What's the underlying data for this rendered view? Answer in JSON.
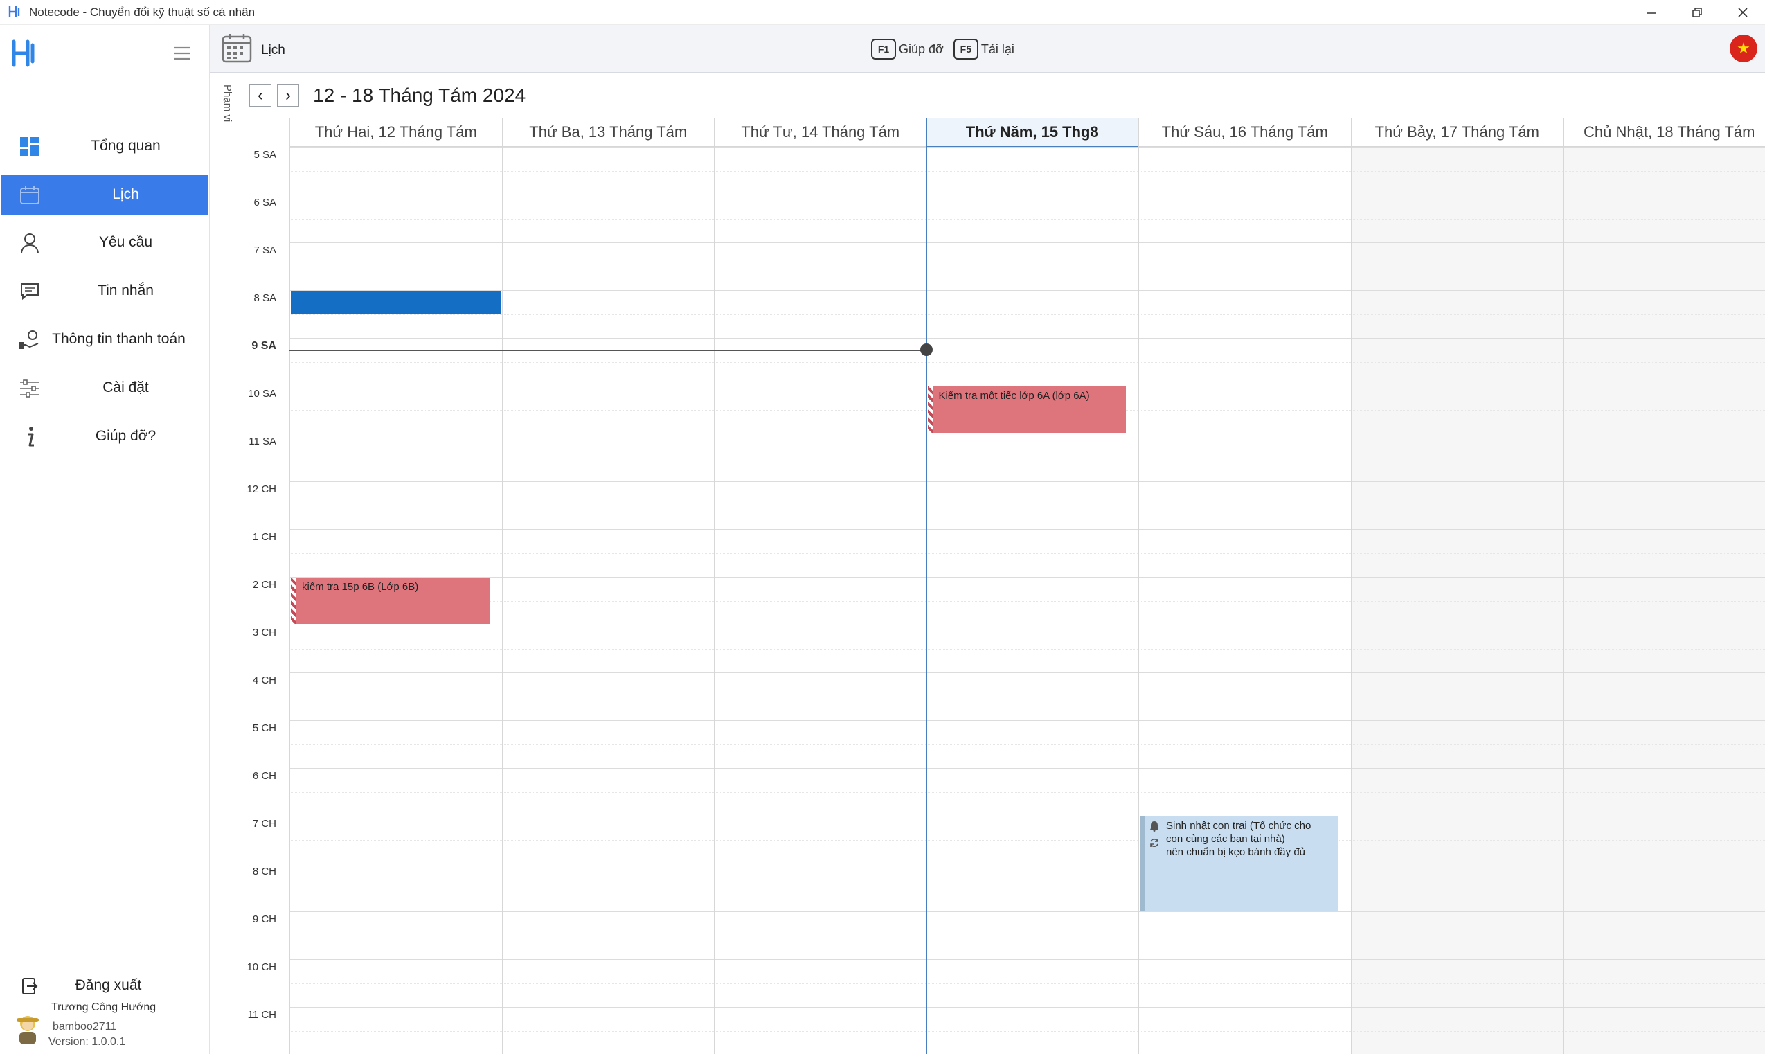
{
  "window": {
    "title": "Notecode - Chuyển đổi kỹ thuật số cá nhân",
    "controls": {
      "minimize": "—",
      "restore": "❐",
      "close": "✕"
    }
  },
  "sidebar": {
    "items": [
      {
        "label": "Tổng quan",
        "icon": "dashboard-icon"
      },
      {
        "label": "Lịch",
        "icon": "calendar-icon",
        "active": true
      },
      {
        "label": "Yêu cầu",
        "icon": "user-icon"
      },
      {
        "label": "Tin nhắn",
        "icon": "message-icon"
      },
      {
        "label": "Thông tin thanh toán",
        "icon": "payment-icon"
      },
      {
        "label": "Cài đặt",
        "icon": "settings-icon"
      },
      {
        "label": "Giúp đỡ?",
        "icon": "info-icon"
      }
    ],
    "logout": "Đăng xuất",
    "user": {
      "name": "Trương Công Hướng",
      "username": "bamboo2711",
      "version": "Version: 1.0.0.1"
    }
  },
  "toolbar": {
    "breadcrumb": "Lịch",
    "help_key": "F1",
    "help_label": "Giúp đỡ",
    "reload_key": "F5",
    "reload_label": "Tải lại",
    "flag": "★"
  },
  "calendar": {
    "range_label": "Phạm vi",
    "range_title": "12 - 18 Tháng Tám 2024",
    "prev": "‹",
    "next": "›",
    "days": [
      "Thứ Hai, 12 Tháng Tám",
      "Thứ Ba, 13 Tháng Tám",
      "Thứ Tư, 14 Tháng Tám",
      "Thứ Năm, 15 Thg8",
      "Thứ Sáu, 16 Tháng Tám",
      "Thứ Bảy, 17 Tháng Tám",
      "Chủ Nhật, 18 Tháng Tám"
    ],
    "today_index": 3,
    "weekend_indices": [
      5,
      6
    ],
    "hours": [
      "5 SA",
      "6 SA",
      "7 SA",
      "8 SA",
      "9 SA",
      "10 SA",
      "11 SA",
      "12 CH",
      "1 CH",
      "2 CH",
      "3 CH",
      "4 CH",
      "5 CH",
      "6 CH",
      "7 CH",
      "8 CH",
      "9 CH",
      "10 CH",
      "11 CH"
    ],
    "current_hour_label": "9 SA",
    "events": [
      {
        "day": 0,
        "start": 8.0,
        "end": 8.5,
        "style": "blue-block",
        "text": ""
      },
      {
        "day": 3,
        "start": 10.0,
        "end": 11.0,
        "style": "red",
        "text": "Kiểm tra một tiếc lớp 6A (lớp 6A)"
      },
      {
        "day": 0,
        "start": 14.0,
        "end": 15.0,
        "style": "red",
        "text": "kiểm tra 15p 6B (Lớp 6B)"
      },
      {
        "day": 4,
        "start": 19.0,
        "end": 21.0,
        "style": "light",
        "lines": [
          "Sinh nhật con trai (Tổ chức cho",
          "con cùng các bạn tại nhà)",
          "nên chuẩn bị kẹo bánh đầy đủ"
        ]
      }
    ],
    "now_time": 9.25
  }
}
